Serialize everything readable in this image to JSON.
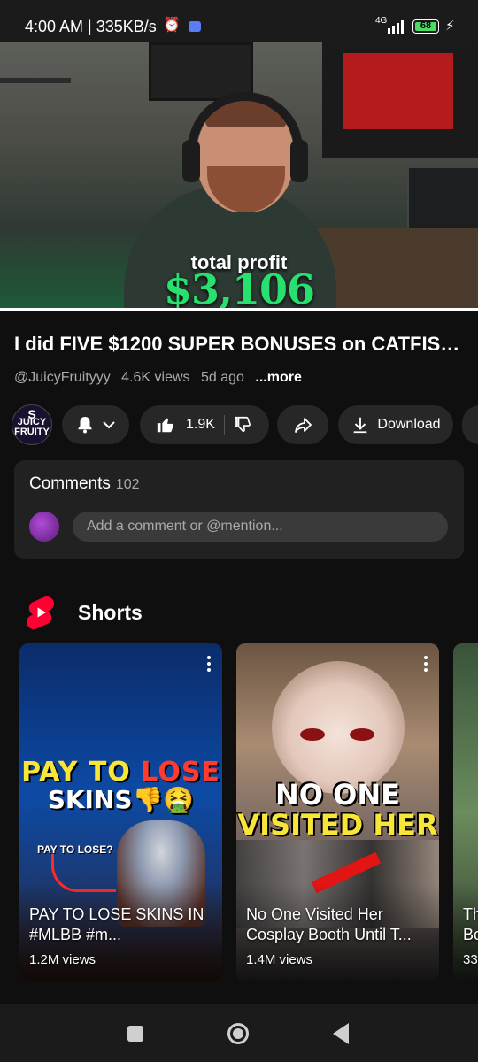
{
  "status_bar": {
    "time": "4:00 AM | 335KB/s",
    "network": "4G",
    "battery": "68"
  },
  "video": {
    "overlay_label": "total profit",
    "overlay_value": "$3,106",
    "progress": 1.0
  },
  "title": "I did FIVE $1200 SUPER BONUSES on CATFISH...",
  "meta": {
    "channel_handle": "@JuicyFruityyy",
    "views": "4.6K views",
    "age": "5d ago",
    "more": "...more"
  },
  "channel_avatar": {
    "letter": "S",
    "text": "JUICY FRUITY"
  },
  "actions": {
    "likes": "1.9K",
    "download": "Download"
  },
  "comments": {
    "label": "Comments",
    "count": "102",
    "placeholder": "Add a comment or @mention..."
  },
  "shorts": {
    "title": "Shorts",
    "items": [
      {
        "title": "PAY TO LOSE SKINS IN #MLBB #m...",
        "views": "1.2M views",
        "thumb_line1a": "PAY",
        "thumb_line1b": "TO",
        "thumb_line1c": "LOSE",
        "thumb_line2": "SKINS👎🤮",
        "thumb_small": "PAY TO LOSE?"
      },
      {
        "title": "No One Visited Her Cosplay Booth Until T...",
        "views": "1.4M views",
        "thumb_line1": "NO ONE",
        "thumb_line2": "VISITED HER"
      },
      {
        "title": "Th Bo",
        "views": "33"
      }
    ]
  },
  "colors": {
    "accent_green": "#27e06f",
    "shorts_red": "#ff0033",
    "pill_bg": "#272727"
  },
  "icons": [
    "alarm-icon",
    "chat-bubble-icon",
    "signal-icon",
    "battery-icon",
    "bolt-icon",
    "bell-icon",
    "chevron-down-icon",
    "thumbs-up-icon",
    "thumbs-down-icon",
    "share-icon",
    "download-icon",
    "shorts-logo-icon",
    "more-vert-icon",
    "nav-recents-icon",
    "nav-home-icon",
    "nav-back-icon"
  ]
}
